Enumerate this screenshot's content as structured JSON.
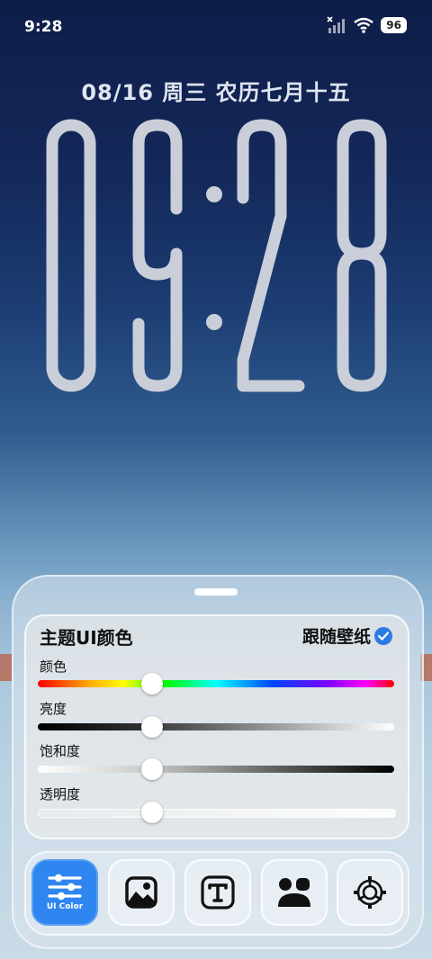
{
  "status_bar": {
    "time": "9:28",
    "battery": "96"
  },
  "lockscreen": {
    "date": "08/16 周三 农历七月十五",
    "clock": "09:28"
  },
  "panel": {
    "title": "主题UI颜色",
    "follow_label": "跟随壁纸",
    "follow_checked": true,
    "sliders": [
      {
        "label": "颜色",
        "value": 0.32
      },
      {
        "label": "亮度",
        "value": 0.32
      },
      {
        "label": "饱和度",
        "value": 0.32
      },
      {
        "label": "透明度",
        "value": 0.32
      }
    ]
  },
  "toolbar": {
    "items": [
      {
        "icon": "sliders-icon",
        "label": "UI Color",
        "active": true
      },
      {
        "icon": "image-icon",
        "label": "",
        "active": false
      },
      {
        "icon": "text-icon",
        "label": "",
        "active": false
      },
      {
        "icon": "people-icon",
        "label": "",
        "active": false
      },
      {
        "icon": "gear-icon",
        "label": "",
        "active": false
      }
    ]
  },
  "colors": {
    "accent": "#2f86f0",
    "check": "#2c7be5"
  }
}
